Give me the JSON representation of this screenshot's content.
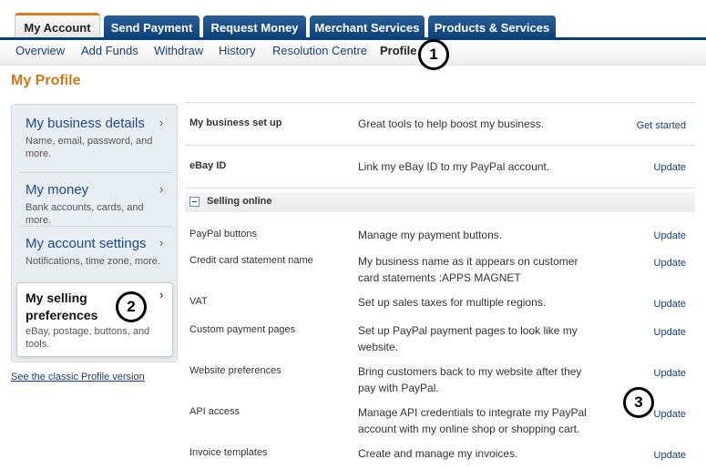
{
  "tabs": [
    {
      "label": "My Account"
    },
    {
      "label": "Send Payment"
    },
    {
      "label": "Request Money"
    },
    {
      "label": "Merchant Services"
    },
    {
      "label": "Products & Services"
    }
  ],
  "subnav": [
    {
      "label": "Overview"
    },
    {
      "label": "Add Funds"
    },
    {
      "label": "Withdraw"
    },
    {
      "label": "History"
    },
    {
      "label": "Resolution Centre"
    },
    {
      "label": "Profile"
    }
  ],
  "page_title": "My Profile",
  "leftnav": {
    "items": [
      {
        "title": "My business details",
        "desc": "Name, email, password, and more."
      },
      {
        "title": "My money",
        "desc": "Bank accounts, cards, and more."
      },
      {
        "title": "My account settings",
        "desc": "Notifications, time zone, more."
      },
      {
        "title": "My selling preferences",
        "desc": "eBay, postage, buttons, and tools."
      }
    ],
    "chevron": "›",
    "classic_link": "See the classic Profile version"
  },
  "main": {
    "top_rows": [
      {
        "name": "My business set up",
        "desc": "Great tools to help boost my business.",
        "action": "Get started"
      },
      {
        "name": "eBay ID",
        "desc": "Link my eBay ID to my PayPal account.",
        "action": "Update"
      }
    ],
    "section": {
      "title": "Selling online",
      "icon": "collapse-icon"
    },
    "rows": [
      {
        "name": "PayPal buttons",
        "desc": "Manage my payment buttons.",
        "action": "Update"
      },
      {
        "name": "Credit card statement name",
        "desc": "My business name as it appears on customer card statements :APPS MAGNET",
        "action": "Update"
      },
      {
        "name": "VAT",
        "desc": "Set up sales taxes for multiple regions.",
        "action": "Update"
      },
      {
        "name": "Custom payment pages",
        "desc": "Set up PayPal payment pages to look like my website.",
        "action": "Update"
      },
      {
        "name": "Website preferences",
        "desc": "Bring customers back to my website after they pay with PayPal.",
        "action": "Update"
      },
      {
        "name": "API access",
        "desc": "Manage API credentials to integrate my PayPal account with my online shop or shopping cart.",
        "action": "Update"
      },
      {
        "name": "Invoice templates",
        "desc": "Create and manage my invoices.",
        "action": "Update"
      }
    ]
  },
  "callouts": [
    "1",
    "2",
    "3"
  ],
  "colors": {
    "tab_blue": "#0b3f78",
    "accent_orange": "#e07b20",
    "title_orange": "#cc7a1d",
    "link_blue": "#1a3d7c"
  }
}
